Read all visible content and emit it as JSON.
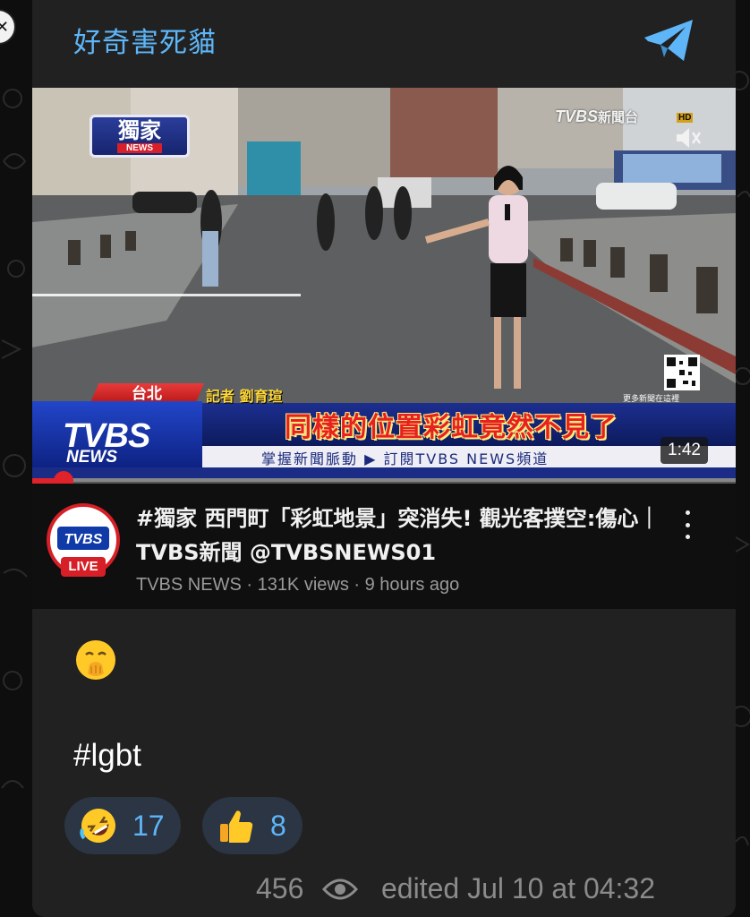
{
  "channel": {
    "title": "好奇害死貓",
    "share_icon": "telegram-share-icon"
  },
  "video": {
    "exclusive_badge": "獨家",
    "exclusive_badge_sub": "NEWS",
    "channel_bug": "TVBS",
    "channel_bug_suffix": "新聞台",
    "hd_badge": "HD",
    "location_tag": "台北",
    "reporter_tag": "記者 劉育瑄",
    "headline": "同樣的位置彩虹竟然不見了",
    "logo_text": "TVBS",
    "logo_sub": "NEWS",
    "ticker": "掌握新聞脈動 ▶ 訂閱TVBS NEWS頻道",
    "qr_caption": "更多新聞在這裡",
    "duration": "1:42",
    "progress": 0.045
  },
  "meta": {
    "live_badge": "LIVE",
    "avatar_logo": "TVBS",
    "title": "#獨家 西門町「彩虹地景」突消失! 觀光客撲空:傷心｜ TVBS新聞 @TVBSNEWS01",
    "subtitle": "TVBS NEWS · 131K views · 9 hours ago",
    "menu_icon": "more-vertical-icon"
  },
  "message": {
    "emoji": "hand-over-mouth-emoji",
    "hashtag": "#lgbt"
  },
  "reactions": [
    {
      "emoji": "rolling-on-floor-laughing-emoji",
      "count": "17"
    },
    {
      "emoji": "thumbs-up-emoji",
      "count": "8"
    }
  ],
  "footer": {
    "views": "456",
    "edited": "edited  Jul 10 at 04:32"
  },
  "colors": {
    "accent": "#5eb5f7",
    "bubble": "#212121",
    "reaction_bg": "#2b3543",
    "youtube_red": "#e0222a"
  }
}
